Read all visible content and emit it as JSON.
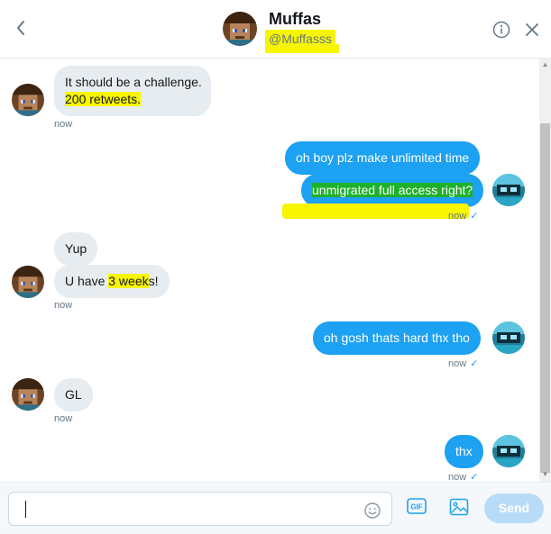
{
  "header": {
    "name": "Muffas",
    "handle": "@Muffasss",
    "back_icon": "chevron-left-icon",
    "info_icon": "info-icon",
    "close_icon": "close-icon"
  },
  "messages": [
    {
      "direction": "in",
      "text_parts": [
        "It should be a challenge."
      ],
      "text2_parts": [
        "200 retweets."
      ],
      "timestamp": "now"
    },
    {
      "direction": "out",
      "text": "oh boy plz make unlimited time"
    },
    {
      "direction": "out",
      "text": "unmigrated full access right?",
      "timestamp": "now"
    },
    {
      "direction": "in",
      "text": "Yup"
    },
    {
      "direction": "in",
      "text_before": "U have ",
      "text_highlight": "3 week",
      "text_after": "s!",
      "timestamp": "now"
    },
    {
      "direction": "out",
      "text": "oh gosh thats hard thx tho",
      "timestamp": "now"
    },
    {
      "direction": "in",
      "text": "GL",
      "timestamp": "now"
    },
    {
      "direction": "out",
      "text": "thx",
      "timestamp": "now"
    }
  ],
  "read_check": "✓",
  "composer": {
    "placeholder": "",
    "emoji_icon": "emoji-icon",
    "gif_label": "GIF",
    "image_icon": "image-icon",
    "send_label": "Send"
  },
  "colors": {
    "outgoing_bubble": "#1da1f2",
    "incoming_bubble": "#e6ecf0",
    "highlight_yellow": "#f7f500",
    "highlight_green": "#1db12c",
    "send_disabled": "#b8dcf7"
  }
}
